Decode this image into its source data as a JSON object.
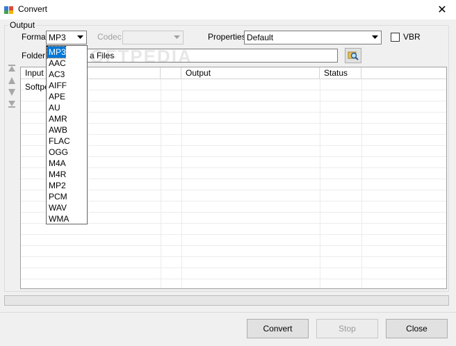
{
  "window": {
    "title": "Convert"
  },
  "output_group": {
    "label": "Output"
  },
  "format": {
    "label": "Format",
    "value": "MP3"
  },
  "codec": {
    "label": "Codec",
    "value": ""
  },
  "properties": {
    "label": "Properties",
    "value": "Default"
  },
  "vbr": {
    "label": "VBR",
    "checked": false
  },
  "folder": {
    "label": "Folder",
    "value": "a Files"
  },
  "grid": {
    "columns": [
      "Input",
      "",
      "Output",
      "Status",
      ""
    ],
    "rows": [
      {
        "input": "Softpe"
      }
    ]
  },
  "watermark": "SOFTPEDIA",
  "format_options": [
    "MP3",
    "AAC",
    "AC3",
    "AIFF",
    "APE",
    "AU",
    "AMR",
    "AWB",
    "FLAC",
    "OGG",
    "M4A",
    "M4R",
    "MP2",
    "PCM",
    "WAV",
    "WMA"
  ],
  "buttons": {
    "convert": "Convert",
    "stop": "Stop",
    "close": "Close"
  },
  "icons": {
    "app": "app-icon",
    "close": "close-icon",
    "browse": "folder-search-icon",
    "move_top": "arrow-top-icon",
    "move_up": "arrow-up-icon",
    "move_down": "arrow-down-icon",
    "move_bottom": "arrow-bottom-icon"
  },
  "colors": {
    "selection": "#0078d7"
  }
}
